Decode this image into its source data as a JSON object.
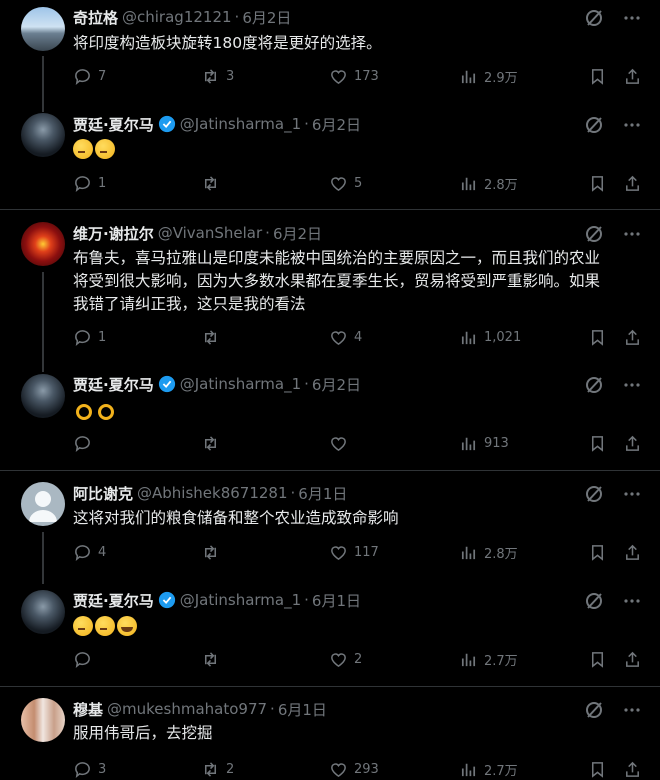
{
  "tweets": [
    {
      "name": "奇拉格",
      "handle": "@chirag12121",
      "date": "6月2日",
      "text": "将印度构造板块旋转180度将是更好的选择。",
      "replies": "7",
      "retweets": "3",
      "likes": "173",
      "views": "2.9万"
    },
    {
      "name": "贾廷·夏尔马",
      "handle": "@Jatinsharma_1",
      "date": "6月2日",
      "emoji": [
        "think",
        "think"
      ],
      "replies": "1",
      "retweets": "",
      "likes": "5",
      "views": "2.8万"
    },
    {
      "name": "维万·谢拉尔",
      "handle": "@VivanShelar",
      "date": "6月2日",
      "text_lines": [
        "布鲁夫，喜马拉雅山是印度未能被中国统治的主要原因之一，而且我们的农业",
        "将受到很大影响，因为大多数水果都在夏季生长，贸易将受到严重影响。如果",
        "我错了请纠正我，这只是我的看法"
      ],
      "replies": "1",
      "retweets": "",
      "likes": "4",
      "views": "1,021"
    },
    {
      "name": "贾廷·夏尔马",
      "handle": "@Jatinsharma_1",
      "date": "6月2日",
      "emoji": [
        "ok",
        "ok"
      ],
      "replies": "",
      "retweets": "",
      "likes": "",
      "views": "913"
    },
    {
      "name": "阿比谢克",
      "handle": "@Abhishek8671281",
      "date": "6月1日",
      "text": "这将对我们的粮食储备和整个农业造成致命影响",
      "replies": "4",
      "retweets": "",
      "likes": "117",
      "views": "2.8万"
    },
    {
      "name": "贾廷·夏尔马",
      "handle": "@Jatinsharma_1",
      "date": "6月1日",
      "emoji": [
        "think",
        "think",
        "laugh"
      ],
      "replies": "",
      "retweets": "",
      "likes": "2",
      "views": "2.7万"
    },
    {
      "name": "穆基",
      "handle": "@mukeshmahato977",
      "date": "6月1日",
      "text": "服用伟哥后，去挖掘",
      "replies": "3",
      "retweets": "2",
      "likes": "293",
      "views": "2.7万"
    }
  ],
  "colors": {
    "background": "#000000",
    "muted": "#71767b",
    "text": "#e7e9ea",
    "verified": "#1d9bf0"
  },
  "icons": [
    "grok-icon",
    "more-icon",
    "reply-icon",
    "retweet-icon",
    "like-icon",
    "views-icon",
    "bookmark-icon",
    "share-icon",
    "verified-badge-icon"
  ]
}
